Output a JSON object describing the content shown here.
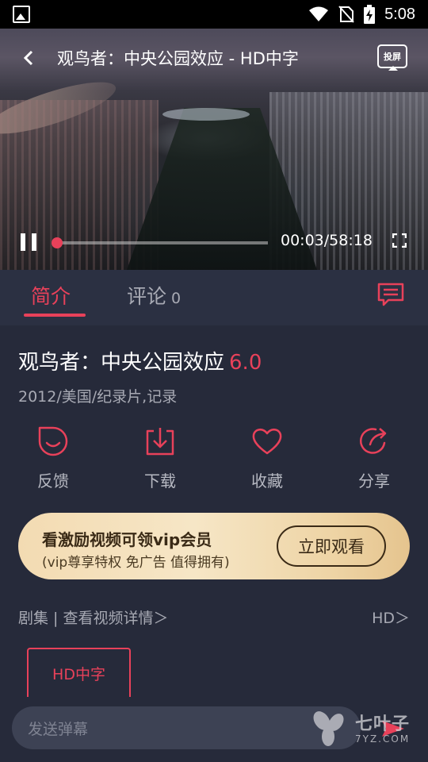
{
  "status_bar": {
    "time": "5:08"
  },
  "player": {
    "title": "观鸟者：中央公园效应 - HD中字",
    "cast_label": "投屏",
    "time_text": "00:03/58:18",
    "progress_fraction": 0.001
  },
  "tabs": {
    "intro_label": "简介",
    "comments_label": "评论",
    "comments_count": "0"
  },
  "movie": {
    "title": "观鸟者：中央公园效应",
    "rating": "6.0",
    "meta": "2012/美国/纪录片,记录"
  },
  "actions": [
    {
      "label": "反馈",
      "icon": "smile-icon"
    },
    {
      "label": "下载",
      "icon": "download-icon"
    },
    {
      "label": "收藏",
      "icon": "heart-icon"
    },
    {
      "label": "分享",
      "icon": "share-icon"
    }
  ],
  "vip_banner": {
    "title": "看激励视频可领vip会员",
    "subtitle": "(vip尊享特权 免广告 值得拥有)",
    "button_label": "立即观看"
  },
  "episodes": {
    "left_label": "剧集 | 查看视频详情＞",
    "right_label": "HD＞",
    "items": [
      "HD中字"
    ]
  },
  "danmaku": {
    "placeholder": "发送弹幕"
  },
  "watermark": {
    "text": "七叶子",
    "sub": "7YZ.COM"
  },
  "colors": {
    "accent": "#e8415a",
    "background": "#262a3a",
    "tab_bar": "#2b3042"
  }
}
